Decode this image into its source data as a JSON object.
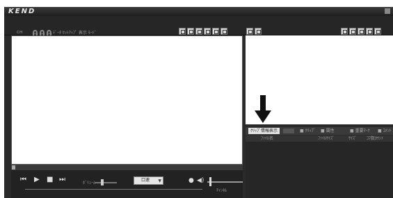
{
  "app": {
    "logo": "KEND",
    "brand_color": "#2a2a2a"
  },
  "toolbar": {
    "left_label": "ᴄʜ",
    "counter": "000",
    "status_text": "ﾃﾞｰﾀ  ｾｯﾄｱｯﾌﾟ 表示 ﾓｰﾄﾞ"
  },
  "icons": {
    "left_group": [
      "camera-icon",
      "copy-icon",
      "zoom-icon",
      "crop-icon",
      "export-icon",
      "settings-icon"
    ],
    "mid_group": [
      "folder-icon",
      "import-icon"
    ],
    "right_group": [
      "camera-icon",
      "copy-icon",
      "zoom-icon",
      "crop-icon",
      "settings-icon"
    ]
  },
  "panel_tabs": {
    "active": "ｸﾘｯﾌﾟ情報表示",
    "items": [
      "■ ｸﾘｯﾌﾟ",
      "■ 属性",
      "■ 重要ﾏｰｸ",
      "■ ｺﾒﾝﾄ"
    ]
  },
  "list_columns": [
    "ﾌｧｲﾙ名",
    "ﾌｧｲﾙｻｲｽﾞ",
    "ｻｲｽﾞ",
    "ｺﾏ数ｶｳﾝﾄ"
  ],
  "player": {
    "volume_label": "ﾎﾞﾘｭｰﾑ",
    "speed_dropdown": "口速",
    "small_label": "ﾁｬﾝﾈﾙ"
  }
}
